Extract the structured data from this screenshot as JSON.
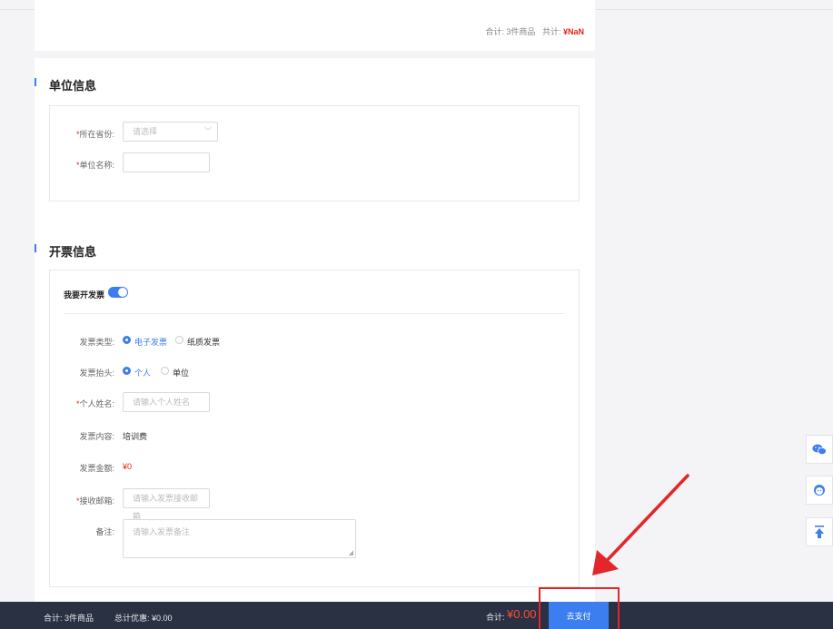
{
  "summary": {
    "total_label": "合计:",
    "item_count": "3件商品",
    "sum_label": "共计:",
    "sum_value": "¥NaN"
  },
  "unit_section": {
    "title": "单位信息",
    "province_label": "所在省份:",
    "province_placeholder": "请选择",
    "unit_name_label": "单位名称:"
  },
  "invoice_section": {
    "title": "开票信息",
    "want_invoice_label": "我要开发票",
    "want_invoice_enabled": true,
    "type_label": "发票类型:",
    "type_options": [
      "电子发票",
      "纸质发票"
    ],
    "type_selected": "电子发票",
    "header_label": "发票抬头:",
    "header_options": [
      "个人",
      "单位"
    ],
    "header_selected": "个人",
    "name_label": "个人姓名:",
    "name_placeholder": "请输入个人姓名",
    "content_label": "发票内容:",
    "content_value": "培训费",
    "amount_label": "发票金额:",
    "amount_value": "¥0",
    "email_label": "接收邮箱:",
    "email_placeholder": "请输入发票接收邮箱",
    "remark_label": "备注:",
    "remark_placeholder": "请输入发票备注"
  },
  "bottom_bar": {
    "count_text": "合计: 3件商品",
    "discount_text": "总计优惠: ¥0.00",
    "total_label": "合计:",
    "total_value": "¥0.00",
    "pay_button": "去支付"
  },
  "side_tools": {
    "items": [
      "wechat-icon",
      "customer-service-icon",
      "back-to-top-icon"
    ]
  },
  "colors": {
    "accent": "#3c7df0",
    "price_red": "#e2231a",
    "bottom_bar": "#2a3142",
    "annotation_red": "#e3262a"
  }
}
